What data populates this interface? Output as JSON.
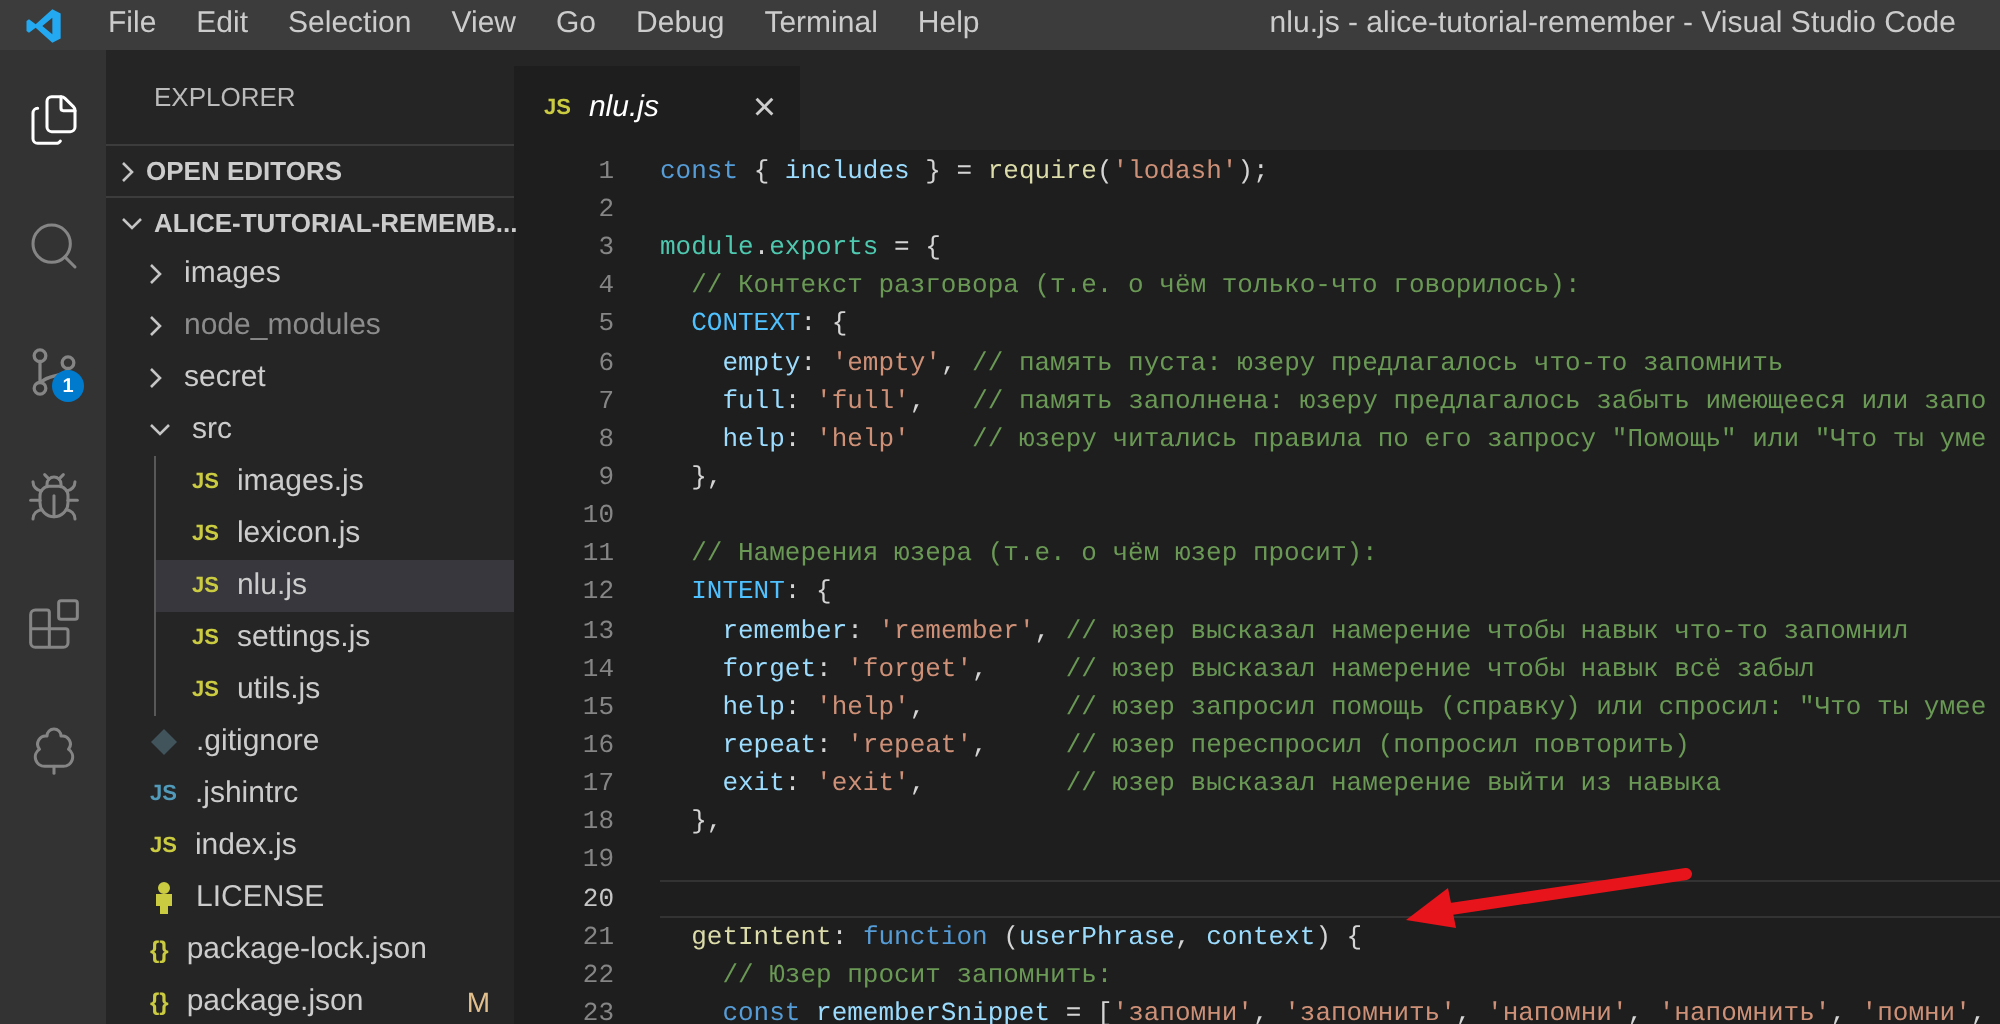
{
  "window": {
    "title": "nlu.js - alice-tutorial-remember - Visual Studio Code"
  },
  "menu": [
    "File",
    "Edit",
    "Selection",
    "View",
    "Go",
    "Debug",
    "Terminal",
    "Help"
  ],
  "activity_bar": [
    {
      "kind": "explorer",
      "selected": true
    },
    {
      "kind": "search",
      "selected": false
    },
    {
      "kind": "source-control",
      "selected": false,
      "badge": "1"
    },
    {
      "kind": "debug",
      "selected": false
    },
    {
      "kind": "extensions",
      "selected": false
    },
    {
      "kind": "tree",
      "selected": false
    }
  ],
  "sidebar": {
    "title": "EXPLORER",
    "sections": [
      {
        "label": "OPEN EDITORS",
        "expanded": false
      },
      {
        "label": "ALICE-TUTORIAL-REMEMB...",
        "expanded": true
      }
    ],
    "tree": [
      {
        "label": "images",
        "kind": "folder",
        "expanded": false,
        "dimmed": false,
        "selected": false
      },
      {
        "label": "node_modules",
        "kind": "folder",
        "expanded": false,
        "dimmed": true,
        "selected": false
      },
      {
        "label": "secret",
        "kind": "folder",
        "expanded": false,
        "dimmed": false,
        "selected": false
      },
      {
        "label": "src",
        "kind": "folder",
        "expanded": true,
        "dimmed": false,
        "selected": false,
        "children": [
          {
            "label": "images.js",
            "kind": "js",
            "icon_text": "JS",
            "dimmed": false,
            "selected": false
          },
          {
            "label": "lexicon.js",
            "kind": "js",
            "icon_text": "JS",
            "dimmed": false,
            "selected": false
          },
          {
            "label": "nlu.js",
            "kind": "js",
            "icon_text": "JS",
            "dimmed": false,
            "selected": true
          },
          {
            "label": "settings.js",
            "kind": "js",
            "icon_text": "JS",
            "dimmed": false,
            "selected": false
          },
          {
            "label": "utils.js",
            "kind": "js",
            "icon_text": "JS",
            "dimmed": false,
            "selected": false
          }
        ]
      },
      {
        "label": ".gitignore",
        "kind": "git",
        "dimmed": false,
        "selected": false
      },
      {
        "label": ".jshintrc",
        "kind": "config",
        "icon_text": "JS",
        "dimmed": false,
        "selected": false
      },
      {
        "label": "index.js",
        "kind": "js",
        "icon_text": "JS",
        "dimmed": false,
        "selected": false
      },
      {
        "label": "LICENSE",
        "kind": "license",
        "dimmed": false,
        "selected": false
      },
      {
        "label": "package-lock.json",
        "kind": "json",
        "icon_text": "{}",
        "dimmed": false,
        "selected": false
      },
      {
        "label": "package.json",
        "kind": "json",
        "icon_text": "{}",
        "dimmed": false,
        "selected": false,
        "badge": "M"
      }
    ]
  },
  "tabs": [
    {
      "label": "nlu.js",
      "icon_text": "JS",
      "selected": true,
      "close": "×"
    }
  ],
  "code": [
    {
      "number": "1",
      "current": false,
      "tokens": [
        {
          "kind": "kw",
          "text": "const"
        },
        {
          "kind": "plain",
          "text": " { "
        },
        {
          "kind": "var",
          "text": "includes"
        },
        {
          "kind": "plain",
          "text": " } = "
        },
        {
          "kind": "fn",
          "text": "require"
        },
        {
          "kind": "plain",
          "text": "("
        },
        {
          "kind": "str",
          "text": "'lodash'"
        },
        {
          "kind": "plain",
          "text": ");"
        }
      ]
    },
    {
      "number": "2",
      "current": false
    },
    {
      "number": "3",
      "current": false,
      "tokens": [
        {
          "kind": "type",
          "text": "module"
        },
        {
          "kind": "plain",
          "text": "."
        },
        {
          "kind": "type",
          "text": "exports"
        },
        {
          "kind": "plain",
          "text": " = {"
        }
      ]
    },
    {
      "number": "4",
      "current": false,
      "tokens": [
        {
          "kind": "com",
          "text": "  // Контекст разговора (т.е. о чём только-что говорилось):"
        }
      ]
    },
    {
      "number": "5",
      "current": false,
      "tokens": [
        {
          "kind": "const",
          "text": "  CONTEXT"
        },
        {
          "kind": "plain",
          "text": ": {"
        }
      ]
    },
    {
      "number": "6",
      "current": false,
      "tokens": [
        {
          "kind": "var",
          "text": "    empty"
        },
        {
          "kind": "plain",
          "text": ": "
        },
        {
          "kind": "str",
          "text": "'empty'"
        },
        {
          "kind": "plain",
          "text": ", "
        },
        {
          "kind": "com",
          "text": "// память пуста: юзеру предлагалось что-то запомнить"
        }
      ]
    },
    {
      "number": "7",
      "current": false,
      "tokens": [
        {
          "kind": "var",
          "text": "    full"
        },
        {
          "kind": "plain",
          "text": ": "
        },
        {
          "kind": "str",
          "text": "'full'"
        },
        {
          "kind": "plain",
          "text": ",   "
        },
        {
          "kind": "com",
          "text": "// память заполнена: юзеру предлагалось забыть имеющееся или запо"
        }
      ]
    },
    {
      "number": "8",
      "current": false,
      "tokens": [
        {
          "kind": "var",
          "text": "    help"
        },
        {
          "kind": "plain",
          "text": ": "
        },
        {
          "kind": "str",
          "text": "'help'"
        },
        {
          "kind": "com",
          "text": "    // юзеру читались правила по его запросу \"Помощь\" или \"Что ты уме"
        }
      ]
    },
    {
      "number": "9",
      "current": false,
      "tokens": [
        {
          "kind": "plain",
          "text": "  },"
        }
      ]
    },
    {
      "number": "10",
      "current": false
    },
    {
      "number": "11",
      "current": false,
      "tokens": [
        {
          "kind": "com",
          "text": "  // Намерения юзера (т.е. о чём юзер просит):"
        }
      ]
    },
    {
      "number": "12",
      "current": false,
      "tokens": [
        {
          "kind": "const",
          "text": "  INTENT"
        },
        {
          "kind": "plain",
          "text": ": {"
        }
      ]
    },
    {
      "number": "13",
      "current": false,
      "tokens": [
        {
          "kind": "var",
          "text": "    remember"
        },
        {
          "kind": "plain",
          "text": ": "
        },
        {
          "kind": "str",
          "text": "'remember'"
        },
        {
          "kind": "plain",
          "text": ", "
        },
        {
          "kind": "com",
          "text": "// юзер высказал намерение чтобы навык что-то запомнил"
        }
      ]
    },
    {
      "number": "14",
      "current": false,
      "tokens": [
        {
          "kind": "var",
          "text": "    forget"
        },
        {
          "kind": "plain",
          "text": ": "
        },
        {
          "kind": "str",
          "text": "'forget'"
        },
        {
          "kind": "plain",
          "text": ",     "
        },
        {
          "kind": "com",
          "text": "// юзер высказал намерение чтобы навык всё забыл"
        }
      ]
    },
    {
      "number": "15",
      "current": false,
      "tokens": [
        {
          "kind": "var",
          "text": "    help"
        },
        {
          "kind": "plain",
          "text": ": "
        },
        {
          "kind": "str",
          "text": "'help'"
        },
        {
          "kind": "plain",
          "text": ",         "
        },
        {
          "kind": "com",
          "text": "// юзер запросил помощь (справку) или спросил: \"Что ты умее"
        }
      ]
    },
    {
      "number": "16",
      "current": false,
      "tokens": [
        {
          "kind": "var",
          "text": "    repeat"
        },
        {
          "kind": "plain",
          "text": ": "
        },
        {
          "kind": "str",
          "text": "'repeat'"
        },
        {
          "kind": "plain",
          "text": ",     "
        },
        {
          "kind": "com",
          "text": "// юзер переспросил (попросил повторить)"
        }
      ]
    },
    {
      "number": "17",
      "current": false,
      "tokens": [
        {
          "kind": "var",
          "text": "    exit"
        },
        {
          "kind": "plain",
          "text": ": "
        },
        {
          "kind": "str",
          "text": "'exit'"
        },
        {
          "kind": "plain",
          "text": ",         "
        },
        {
          "kind": "com",
          "text": "// юзер высказал намерение выйти из навыка"
        }
      ]
    },
    {
      "number": "18",
      "current": false,
      "tokens": [
        {
          "kind": "plain",
          "text": "  },"
        }
      ]
    },
    {
      "number": "19",
      "current": false
    },
    {
      "number": "20",
      "current": true
    },
    {
      "number": "21",
      "current": false,
      "tokens": [
        {
          "kind": "fn",
          "text": "  getIntent"
        },
        {
          "kind": "plain",
          "text": ": "
        },
        {
          "kind": "kw",
          "text": "function"
        },
        {
          "kind": "plain",
          "text": " ("
        },
        {
          "kind": "var",
          "text": "userPhrase"
        },
        {
          "kind": "plain",
          "text": ", "
        },
        {
          "kind": "var",
          "text": "context"
        },
        {
          "kind": "plain",
          "text": ") {"
        }
      ]
    },
    {
      "number": "22",
      "current": false,
      "tokens": [
        {
          "kind": "com",
          "text": "    // Юзер просит запомнить:"
        }
      ]
    },
    {
      "number": "23",
      "current": false,
      "tokens": [
        {
          "kind": "kw",
          "text": "    const"
        },
        {
          "kind": "var",
          "text": " rememberSnippet"
        },
        {
          "kind": "plain",
          "text": " = ["
        },
        {
          "kind": "str",
          "text": "'запомни'"
        },
        {
          "kind": "plain",
          "text": ", "
        },
        {
          "kind": "str",
          "text": "'запомнить'"
        },
        {
          "kind": "plain",
          "text": ", "
        },
        {
          "kind": "str",
          "text": "'напомни'"
        },
        {
          "kind": "plain",
          "text": ", "
        },
        {
          "kind": "str",
          "text": "'напомнить'"
        },
        {
          "kind": "plain",
          "text": ", "
        },
        {
          "kind": "str",
          "text": "'помни'"
        },
        {
          "kind": "plain",
          "text": ","
        }
      ]
    }
  ]
}
